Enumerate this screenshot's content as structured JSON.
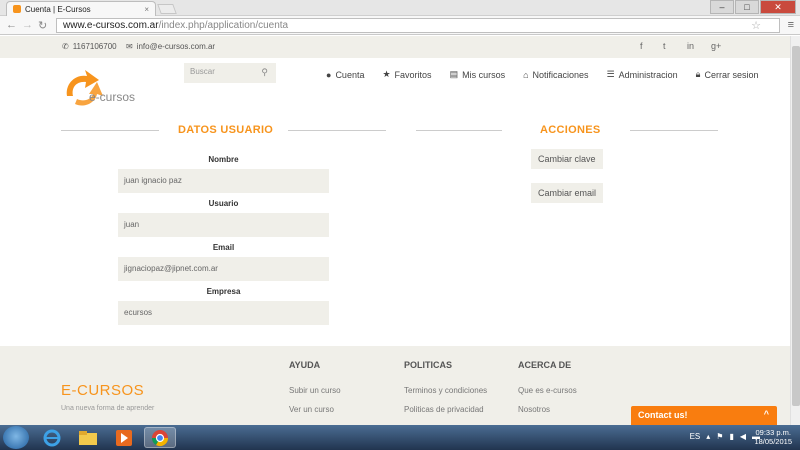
{
  "browser": {
    "tab_title": "Cuenta | E-Cursos",
    "tab_close": "×",
    "url_host": "www.e-cursos.com.ar",
    "url_path": "/index.php/application/cuenta",
    "win_min": "–",
    "win_max": "□",
    "win_close": "✕"
  },
  "topbar": {
    "phone": "1167106700",
    "email": "info@e-cursos.com.ar",
    "social": [
      "f",
      "t",
      "in",
      "g+"
    ]
  },
  "header": {
    "logo_text": "e-cursos",
    "search_placeholder": "Buscar",
    "nav": [
      {
        "label": "Cuenta",
        "icon": "user-icon"
      },
      {
        "label": "Favoritos",
        "icon": "star-icon"
      },
      {
        "label": "Mis cursos",
        "icon": "document-icon"
      },
      {
        "label": "Notificaciones",
        "icon": "inbox-icon"
      },
      {
        "label": "Administracion",
        "icon": "list-icon"
      },
      {
        "label": "Cerrar sesion",
        "icon": "lock-icon"
      }
    ]
  },
  "user_section": {
    "title": "DATOS USUARIO",
    "fields": [
      {
        "label": "Nombre",
        "value": "juan ignacio paz"
      },
      {
        "label": "Usuario",
        "value": "juan"
      },
      {
        "label": "Email",
        "value": "jignaciopaz@jipnet.com.ar"
      },
      {
        "label": "Empresa",
        "value": "ecursos"
      }
    ]
  },
  "actions_section": {
    "title": "ACCIONES",
    "buttons": [
      "Cambiar clave",
      "Cambiar email"
    ]
  },
  "footer": {
    "brand": "E-CURSOS",
    "tagline": "Una nueva forma de aprender",
    "columns": [
      {
        "title": "AYUDA",
        "links": [
          "Subir un curso",
          "Ver un curso"
        ]
      },
      {
        "title": "POLITICAS",
        "links": [
          "Terminos y condiciones",
          "Politicas de privacidad"
        ]
      },
      {
        "title": "ACERCA DE",
        "links": [
          "Que es e-cursos",
          "Nosotros"
        ]
      }
    ],
    "contact_label": "Contact us!"
  },
  "taskbar": {
    "lang": "ES",
    "time": "09:33 p.m.",
    "date": "18/05/2015"
  },
  "colors": {
    "accent": "#f7941d",
    "panel_bg": "#f0efe9",
    "contact_bg": "#f97d0f"
  }
}
